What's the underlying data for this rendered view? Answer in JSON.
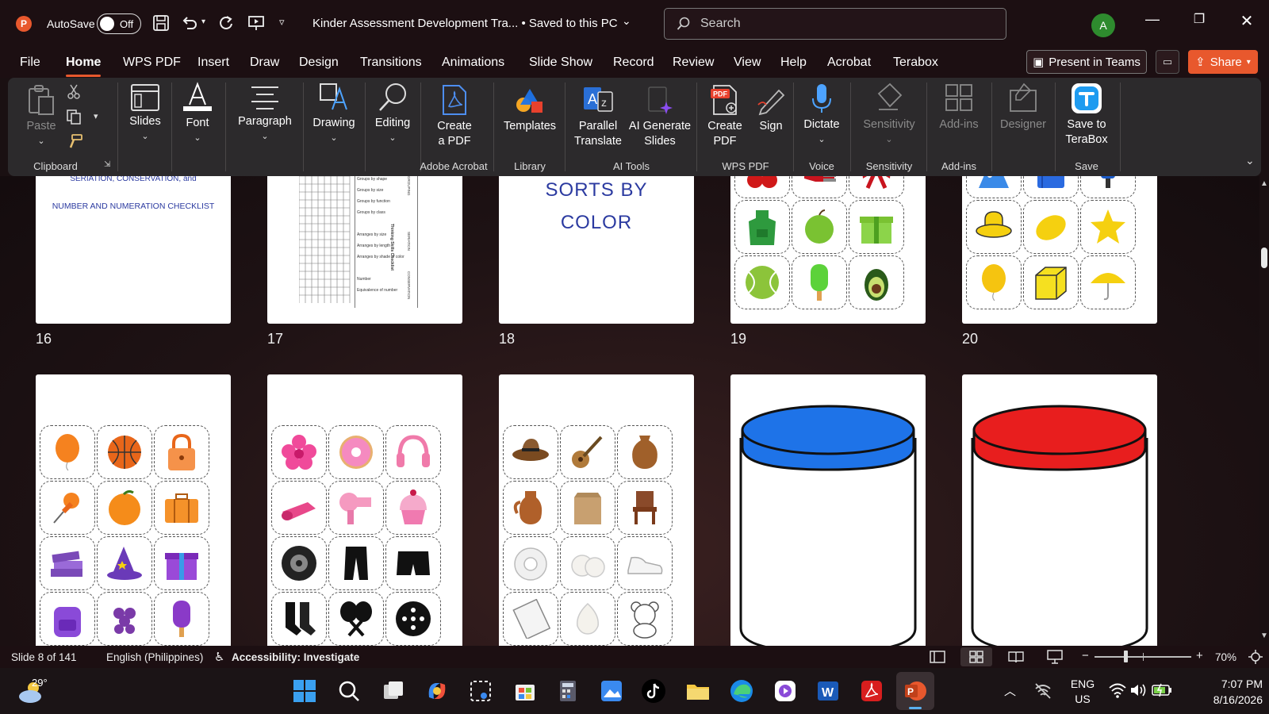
{
  "app": {
    "logo_letter": "P",
    "autosave_label": "AutoSave",
    "autosave_state": "Off",
    "document_title": "Kinder Assessment Development Tra...  •  Saved to this PC",
    "search_placeholder": "Search",
    "avatar_letter": "A"
  },
  "menu": [
    "File",
    "Home",
    "WPS PDF",
    "Insert",
    "Draw",
    "Design",
    "Transitions",
    "Animations",
    "Slide Show",
    "Record",
    "Review",
    "View",
    "Help",
    "Acrobat",
    "Terabox"
  ],
  "active_menu": "Home",
  "header_buttons": {
    "present": "Present in Teams",
    "share": "Share"
  },
  "ribbon": {
    "paste": "Paste",
    "slides": "Slides",
    "font": "Font",
    "paragraph": "Paragraph",
    "drawing": "Drawing",
    "editing": "Editing",
    "create_pdf_1": "Create",
    "create_pdf_2": "a PDF",
    "templates": "Templates",
    "parallel_1": "Parallel",
    "parallel_2": "Translate",
    "ai_gen_1": "AI Generate",
    "ai_gen_2": "Slides",
    "wps_create_1": "Create",
    "wps_create_2": "PDF",
    "sign": "Sign",
    "dictate": "Dictate",
    "sensitivity": "Sensitivity",
    "addins": "Add-ins",
    "designer": "Designer",
    "terabox_1": "Save to",
    "terabox_2": "TeraBox",
    "groups": {
      "clipboard": "Clipboard",
      "adobe": "Adobe Acrobat",
      "library": "Library",
      "ai_tools": "AI Tools",
      "wps_pdf": "WPS PDF",
      "voice": "Voice",
      "sensitivity": "Sensitivity",
      "addins": "Add-ins",
      "save": "Save"
    }
  },
  "slides": {
    "s16": {
      "num": "16",
      "line1": "SERIATION, CONSERVATION, and",
      "line2": "NUMBER AND NUMERATION CHECKLIST"
    },
    "s17": {
      "num": "17",
      "rows": [
        "Groups by shape",
        "Groups by size",
        "Groups by function",
        "Groups by class",
        "Arranges by size",
        "Arranges by length",
        "Arranges by shade of color",
        "Number",
        "Equivalence of number"
      ],
      "side1": "Thinking Skills Checklist",
      "side2": "GROUPING",
      "side3": "SERIATION",
      "side4": "CONSERVATION"
    },
    "s18": {
      "num": "18",
      "line1": "SORTS BY",
      "line2": "COLOR"
    },
    "s19": {
      "num": "19"
    },
    "s20": {
      "num": "20"
    }
  },
  "status": {
    "slide": "Slide 8 of 141",
    "language": "English (Philippines)",
    "accessibility": "Accessibility: Investigate",
    "zoom": "70%"
  },
  "taskbar": {
    "temperature": "29°",
    "lang1": "ENG",
    "lang2": "US",
    "time": "7:07 PM",
    "date": "8/16/2026"
  },
  "colors": {
    "accent": "#e8582d",
    "blue_jar": "#1e73e8",
    "red_jar": "#e81e1e",
    "slide_text": "#2b3aa0"
  }
}
